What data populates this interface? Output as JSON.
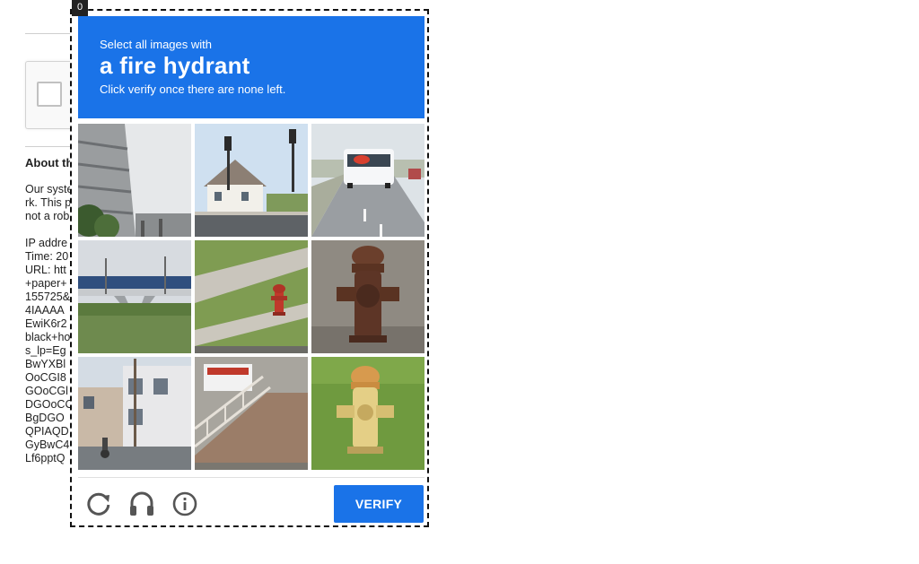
{
  "page": {
    "heading": "About th",
    "paragraph_lines": [
      "Our syste",
      "rk. This p",
      "not a rob"
    ],
    "details_lines": [
      "IP addre",
      "Time: 20",
      "URL: htt",
      "+paper+",
      "155725&",
      "4IAAAA",
      "EwiK6r2",
      "black+ho",
      "s_lp=Eg",
      "BwYXBl",
      "OoCGI8",
      "GOoCGl",
      "DGOoCC",
      "BgDGO",
      "QPIAQD",
      "GyBwC4",
      "Lf6pptQ"
    ]
  },
  "challenge": {
    "counter": "0",
    "prompt_line1": "Select all images with",
    "prompt_target": "a fire hydrant",
    "prompt_line3": "Click verify once there are none left.",
    "tiles": [
      {
        "subject": "parking garage and trees"
      },
      {
        "subject": "street with traffic lights and house"
      },
      {
        "subject": "bus on highway"
      },
      {
        "subject": "highway overpass"
      },
      {
        "subject": "red fire hydrant on sidewalk"
      },
      {
        "subject": "rusty fire hydrant close-up"
      },
      {
        "subject": "street with houses and cyclist"
      },
      {
        "subject": "stairs with railing and sign"
      },
      {
        "subject": "yellow fire hydrant on grass"
      }
    ],
    "icons": {
      "reload": "reload-icon",
      "audio": "headphones-icon",
      "info": "info-icon"
    },
    "verify_label": "VERIFY",
    "colors": {
      "accent": "#1a73e8",
      "icon": "#555555"
    }
  }
}
